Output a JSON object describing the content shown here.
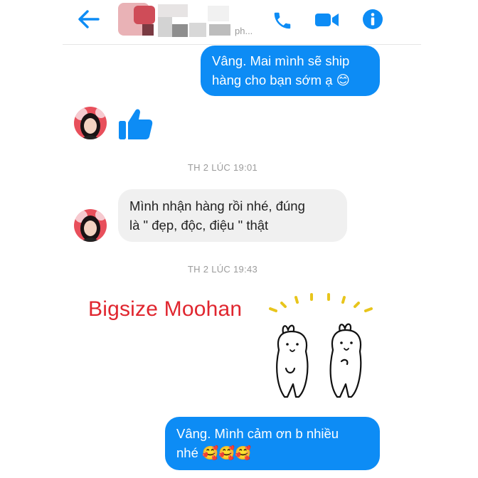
{
  "header": {
    "contact_sub": "ph...",
    "icons": [
      "back-arrow-icon",
      "phone-icon",
      "video-call-icon",
      "info-icon"
    ],
    "accent": "#0d8cf5"
  },
  "messages": {
    "m1_line1": "Vâng. Mai mình sẽ ship",
    "m1_line2": "hàng cho bạn sớm ạ",
    "m1_emoji": "😊",
    "ts1": "TH 2 LÚC 19:01",
    "m2_line1": "Mình nhận hàng rồi nhé, đúng",
    "m2_line2": "là \" đẹp, độc, điệu \" thật",
    "ts2": "TH 2 LÚC 19:43",
    "brand": "Bigsize Moohan",
    "m3_line1": "Vâng. Mình cảm ơn b nhiều",
    "m3_line2": "nhé",
    "m3_emoji": "🥰🥰🥰"
  },
  "colors": {
    "outgoing_bubble": "#0d8cf5",
    "incoming_bubble": "#f0f0f0",
    "brand_text": "#e0262f",
    "timestamp": "#9b9b9b"
  }
}
